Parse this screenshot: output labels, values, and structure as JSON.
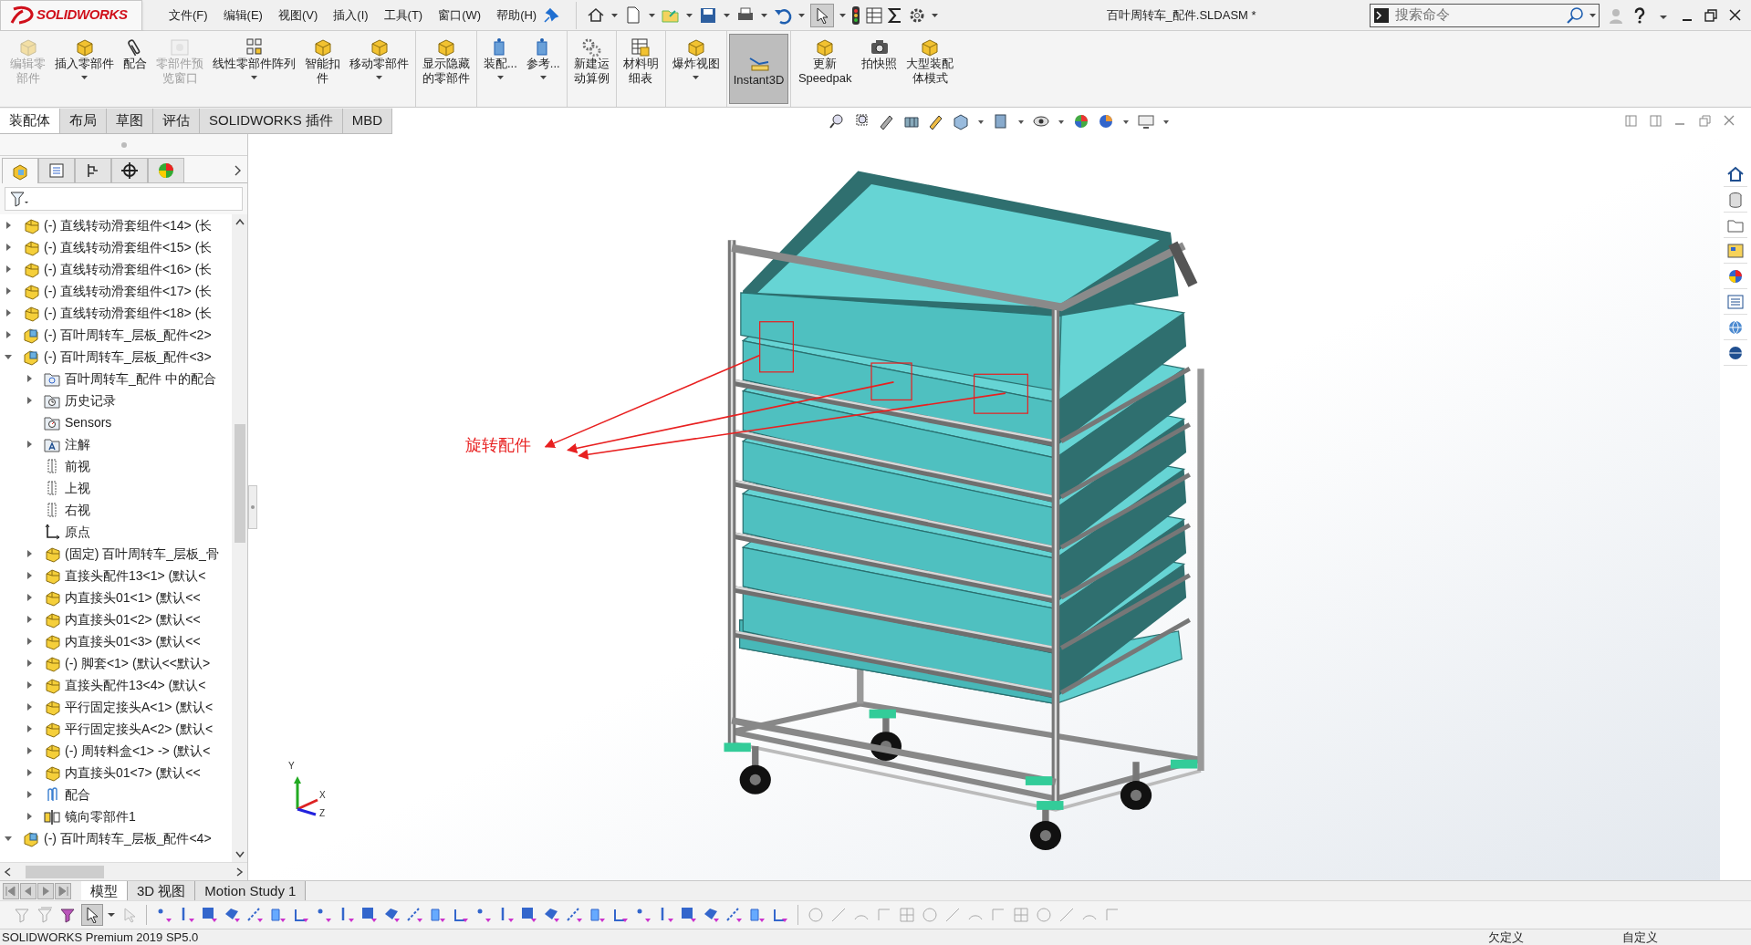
{
  "app": {
    "logo": "SOLIDWORKS",
    "title": "百叶周转车_配件.SLDASM *",
    "search": {
      "placeholder": "搜索命令"
    }
  },
  "menu": [
    "文件(F)",
    "编辑(E)",
    "视图(V)",
    "插入(I)",
    "工具(T)",
    "窗口(W)",
    "帮助(H)"
  ],
  "ribbon": [
    [
      {
        "label": "编辑零部件",
        "disabled": true,
        "dropdown": false,
        "selected": false
      },
      {
        "label": "插入零部件",
        "disabled": false,
        "dropdown": true,
        "selected": false
      },
      {
        "label": "配合",
        "disabled": false,
        "dropdown": false,
        "selected": false
      },
      {
        "label": "零部件预览窗口",
        "disabled": true,
        "dropdown": false,
        "selected": false
      },
      {
        "label": "线性零部件阵列",
        "disabled": false,
        "dropdown": true,
        "selected": false
      },
      {
        "label": "智能扣件",
        "disabled": false,
        "dropdown": false,
        "selected": false
      },
      {
        "label": "移动零部件",
        "disabled": false,
        "dropdown": true,
        "selected": false
      }
    ],
    [
      {
        "label": "显示隐藏的零部件",
        "disabled": false,
        "dropdown": false,
        "selected": false
      }
    ],
    [
      {
        "label": "装配...",
        "disabled": false,
        "dropdown": true,
        "selected": false
      },
      {
        "label": "参考...",
        "disabled": false,
        "dropdown": true,
        "selected": false
      }
    ],
    [
      {
        "label": "新建运动算例",
        "disabled": false,
        "dropdown": false,
        "selected": false
      }
    ],
    [
      {
        "label": "材料明细表",
        "disabled": false,
        "dropdown": false,
        "selected": false
      }
    ],
    [
      {
        "label": "爆炸视图",
        "disabled": false,
        "dropdown": true,
        "selected": false
      }
    ],
    [
      {
        "label": "Instant3D",
        "disabled": false,
        "dropdown": false,
        "selected": true
      }
    ],
    [
      {
        "label": "更新Speedpak",
        "disabled": false,
        "dropdown": false,
        "selected": false
      },
      {
        "label": "拍快照",
        "disabled": false,
        "dropdown": false,
        "selected": false
      },
      {
        "label": "大型装配体模式",
        "disabled": false,
        "dropdown": false,
        "selected": false
      }
    ]
  ],
  "command_tabs": [
    {
      "label": "装配体",
      "selected": true
    },
    {
      "label": "布局",
      "selected": false
    },
    {
      "label": "草图",
      "selected": false
    },
    {
      "label": "评估",
      "selected": false
    },
    {
      "label": "SOLIDWORKS 插件",
      "selected": false
    },
    {
      "label": "MBD",
      "selected": false
    }
  ],
  "panel_tabs": [
    {
      "selected": true
    },
    {
      "selected": false
    },
    {
      "selected": false
    },
    {
      "selected": false
    },
    {
      "selected": false
    }
  ],
  "tree": [
    {
      "label": "(-) 直线转动滑套组件<14> (长",
      "kind": "part",
      "expanded": false
    },
    {
      "label": "(-) 直线转动滑套组件<15> (长",
      "kind": "part",
      "expanded": false
    },
    {
      "label": "(-) 直线转动滑套组件<16> (长",
      "kind": "part",
      "expanded": false
    },
    {
      "label": "(-) 直线转动滑套组件<17> (长",
      "kind": "part",
      "expanded": false
    },
    {
      "label": "(-) 直线转动滑套组件<18> (长",
      "kind": "part",
      "expanded": false
    },
    {
      "label": "(-) 百叶周转车_层板_配件<2>",
      "kind": "assembly",
      "expanded": false
    },
    {
      "label": "(-) 百叶周转车_层板_配件<3>",
      "kind": "assembly",
      "expanded": true,
      "children": [
        {
          "label": "百叶周转车_配件 中的配合",
          "kind": "mates-folder",
          "expanded": false
        },
        {
          "label": "历史记录",
          "kind": "history-folder",
          "expanded": false
        },
        {
          "label": "Sensors",
          "kind": "sensors-folder"
        },
        {
          "label": "注解",
          "kind": "annotations-folder",
          "expanded": false
        },
        {
          "label": "前视",
          "kind": "plane"
        },
        {
          "label": "上视",
          "kind": "plane"
        },
        {
          "label": "右视",
          "kind": "plane"
        },
        {
          "label": "原点",
          "kind": "origin"
        },
        {
          "label": "(固定) 百叶周转车_层板_骨",
          "kind": "part",
          "expanded": false
        },
        {
          "label": "直接头配件13<1> (默认<",
          "kind": "part",
          "expanded": false
        },
        {
          "label": "内直接头01<1> (默认<<",
          "kind": "part",
          "expanded": false
        },
        {
          "label": "内直接头01<2> (默认<<",
          "kind": "part",
          "expanded": false
        },
        {
          "label": "内直接头01<3> (默认<<",
          "kind": "part",
          "expanded": false
        },
        {
          "label": "(-) 脚套<1> (默认<<默认>",
          "kind": "part",
          "expanded": false
        },
        {
          "label": "直接头配件13<4> (默认<",
          "kind": "part",
          "expanded": false
        },
        {
          "label": "平行固定接头A<1> (默认<",
          "kind": "part",
          "expanded": false
        },
        {
          "label": "平行固定接头A<2> (默认<",
          "kind": "part",
          "expanded": false
        },
        {
          "label": "(-) 周转料盒<1> -> (默认<",
          "kind": "part",
          "expanded": false
        },
        {
          "label": "内直接头01<7> (默认<<",
          "kind": "part",
          "expanded": false
        },
        {
          "label": "配合",
          "kind": "mates",
          "expanded": false
        },
        {
          "label": "镜向零部件1",
          "kind": "mirror",
          "expanded": false
        }
      ]
    },
    {
      "label": "(-) 百叶周转车_层板_配件<4>",
      "kind": "assembly",
      "expanded": true
    }
  ],
  "graphics": {
    "annotation": "旋转配件",
    "triad": [
      "Y",
      "X",
      "Z"
    ]
  },
  "bottom_tabs": [
    {
      "label": "模型",
      "selected": true
    },
    {
      "label": "3D 视图",
      "selected": false
    },
    {
      "label": "Motion Study 1",
      "selected": false
    }
  ],
  "status_bar": {
    "product": "SOLIDWORKS Premium 2019 SP5.0",
    "state": "欠定义",
    "units": "自定义"
  }
}
